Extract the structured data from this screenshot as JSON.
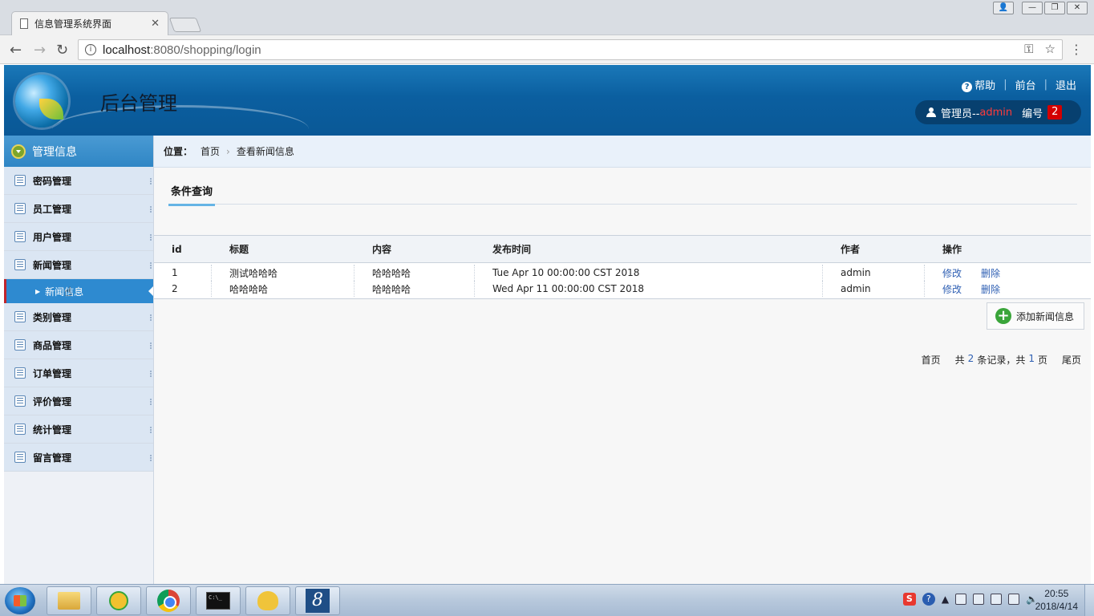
{
  "browser": {
    "tab_title": "信息管理系统界面",
    "tab_close": "✕",
    "url_host": "localhost",
    "url_path": ":8080/shopping/login"
  },
  "header": {
    "site_title": "后台管理",
    "help": "帮助",
    "front": "前台",
    "logout": "退出",
    "admin_prefix": "管理员--",
    "admin_name": "admin",
    "number_label": "编号",
    "number_value": "2"
  },
  "sidebar": {
    "heading": "管理信息",
    "items": [
      {
        "label": "密码管理"
      },
      {
        "label": "员工管理"
      },
      {
        "label": "用户管理"
      },
      {
        "label": "新闻管理"
      },
      {
        "label": "类别管理"
      },
      {
        "label": "商品管理"
      },
      {
        "label": "订单管理"
      },
      {
        "label": "评价管理"
      },
      {
        "label": "统计管理"
      },
      {
        "label": "留言管理"
      }
    ],
    "sub_item": "新闻信息"
  },
  "main": {
    "breadcrumb_label": "位置：",
    "breadcrumb_home": "首页",
    "breadcrumb_current": "查看新闻信息",
    "query_tab": "条件查询",
    "columns": [
      "id",
      "标题",
      "内容",
      "发布时间",
      "作者",
      "操作"
    ],
    "rows": [
      {
        "id": "1",
        "title": "测试哈哈哈",
        "content": "哈哈哈哈",
        "time": "Tue Apr 10 00:00:00 CST 2018",
        "author": "admin",
        "edit": "修改",
        "delete": "删除"
      },
      {
        "id": "2",
        "title": "哈哈哈哈",
        "content": "哈哈哈哈",
        "time": "Wed Apr 11 00:00:00 CST 2018",
        "author": "admin",
        "edit": "修改",
        "delete": "删除"
      }
    ],
    "add_button": "添加新闻信息",
    "pager": {
      "first": "首页",
      "total_prefix": "共",
      "total_records": "2",
      "records_suffix": "条记录，共",
      "total_pages": "1",
      "pages_suffix": "页",
      "last": "尾页"
    }
  },
  "taskbar": {
    "time": "20:55",
    "date": "2018/4/14"
  }
}
